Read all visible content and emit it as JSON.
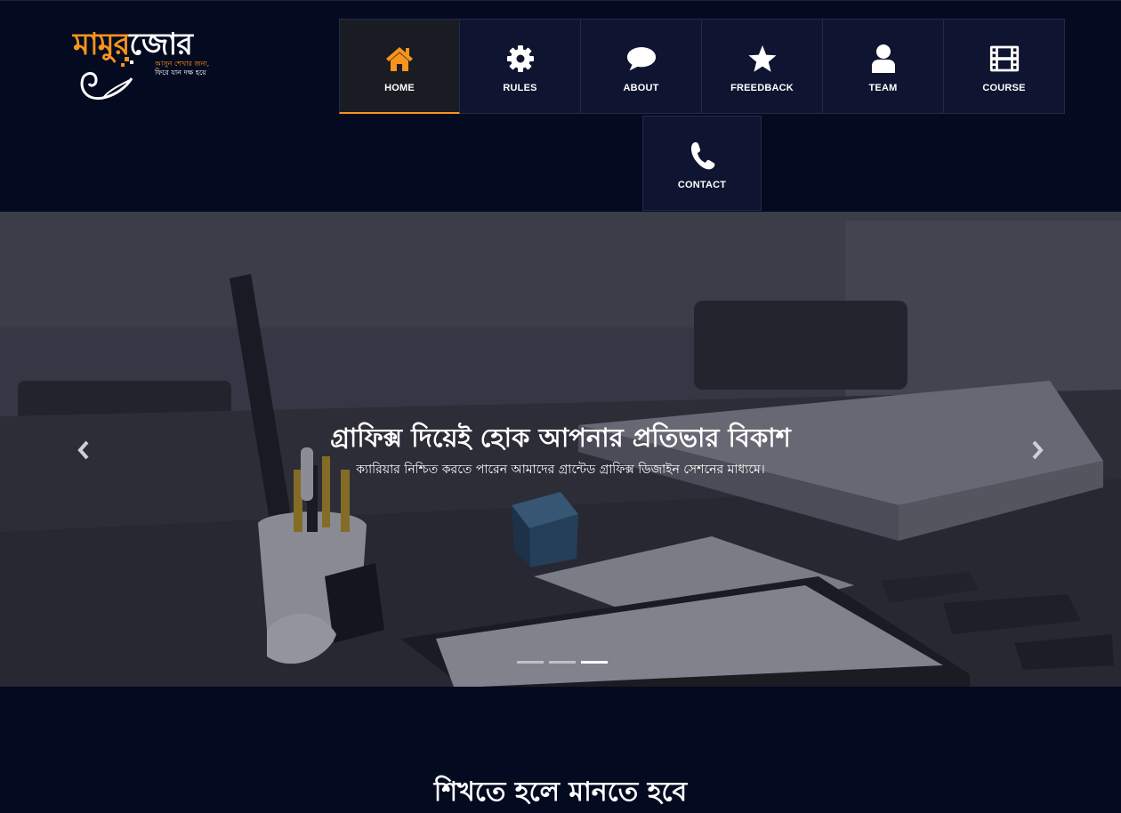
{
  "brand": {
    "logo_primary": "মামুর",
    "logo_secondary": "জোর",
    "tagline_line1": "আসুন শেখার জন্য,",
    "tagline_line2": "ফিরে যান দক্ষ হয়ে"
  },
  "nav": {
    "items": [
      {
        "label": "HOME",
        "icon": "home-icon",
        "active": true
      },
      {
        "label": "RULES",
        "icon": "gear-icon"
      },
      {
        "label": "ABOUT",
        "icon": "speech-bubble-icon"
      },
      {
        "label": "FREEDBACK",
        "icon": "star-icon"
      },
      {
        "label": "TEAM",
        "icon": "user-icon"
      },
      {
        "label": "COURSE",
        "icon": "film-icon"
      }
    ],
    "contact": {
      "label": "CONTACT",
      "icon": "phone-icon"
    }
  },
  "hero": {
    "title": "গ্রাফিক্স দিয়েই হোক আপনার প্রতিভার বিকাশ",
    "subtitle": "ক্যারিয়ার নিশ্চিত করতে পারেন আমাদের গ্রান্টেড গ্রাফিক্স ডিজাইন সেশনের মাধ্যমে।",
    "slide_count": 3,
    "active_slide": 3
  },
  "section": {
    "title": "শিখতে হলে মানতে হবে"
  },
  "colors": {
    "background": "#040a20",
    "nav_tile": "#0f1530",
    "accent": "#f7941d"
  }
}
